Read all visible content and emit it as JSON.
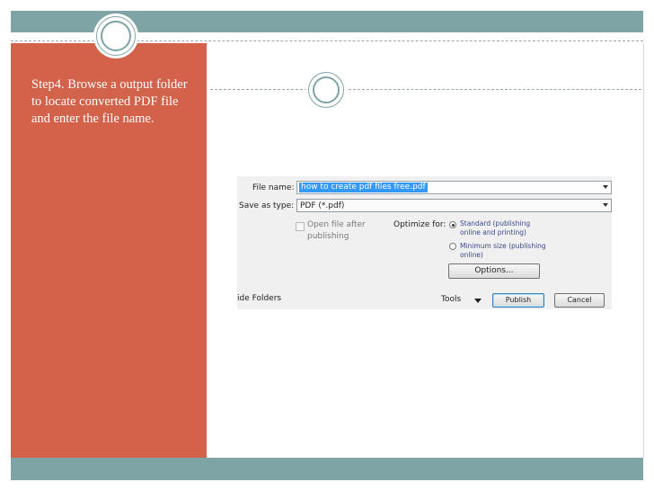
{
  "slide": {
    "step_text": "Step4. Browse a output folder to locate converted PDF file and enter the file name."
  },
  "dialog": {
    "file_name_label": "File name:",
    "file_name_value": "how to create pdf files free.pdf",
    "save_type_label": "Save as type:",
    "save_type_value": "PDF (*.pdf)",
    "open_after_line1": "Open file after",
    "open_after_line2": "publishing",
    "optimize_label": "Optimize for:",
    "standard_line1": "Standard (publishing",
    "standard_line2": "online and printing)",
    "minimum_line1": "Minimum size (publishing",
    "minimum_line2": "online)",
    "options_button": "Options...",
    "hide_folders": "ide Folders",
    "tools_label": "Tools",
    "publish_button": "Publish",
    "cancel_button": "Cancel"
  },
  "colors": {
    "panel": "#d2624a",
    "band": "#7fa4a6",
    "selection": "#3399ff"
  }
}
